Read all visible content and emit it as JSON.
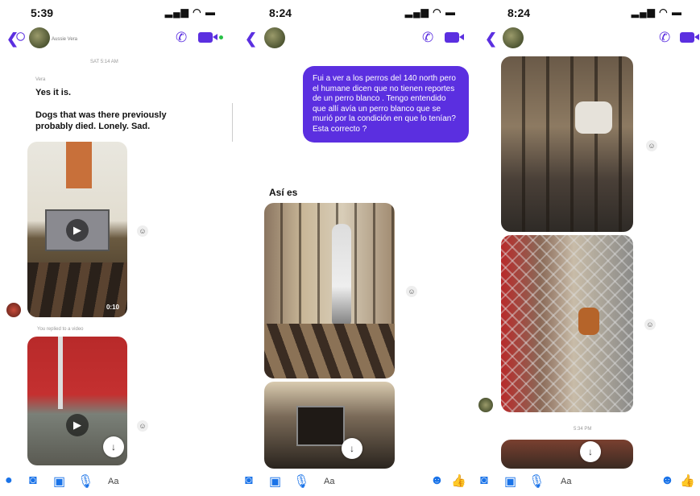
{
  "panel1": {
    "time": "5:39",
    "header_name": "Aussie Vera",
    "timestamp": "SAT 5:14 AM",
    "sender_label": "Vera",
    "msg1": "Yes it is.",
    "msg2": "Dogs that was there previously probably died. Lonely. Sad.",
    "video_duration": "0:10",
    "reply_note": "You replied to a video",
    "composer_placeholder": "Aa"
  },
  "panel2": {
    "time": "8:24",
    "sent_message": "Fui a ver a los perros del 140 north pero el humane dicen que no tienen reportes de un perro blanco . Tengo entendido que allí avía un perro blanco que se murió por la condición en que lo tenían? Esta correcto ?",
    "reply": "Así es",
    "composer_placeholder": "Aa"
  },
  "panel3": {
    "time": "8:24",
    "timestamp": "5:34 PM",
    "composer_placeholder": "Aa"
  },
  "icons": {
    "signal": "signal-icon",
    "wifi": "wifi-icon",
    "battery": "battery-icon"
  },
  "colors": {
    "accent": "#5b2fe0",
    "composer_icons": "#1a73e8"
  }
}
